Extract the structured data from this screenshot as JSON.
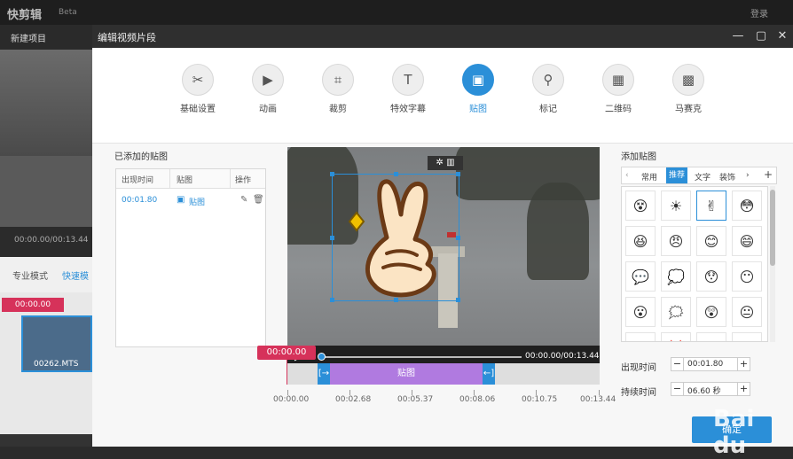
{
  "background_app": {
    "logo": "快剪辑",
    "beta": "Beta",
    "login": "登录",
    "new_project": "新建项目",
    "time_readout": "00:00.00/00:13.44",
    "mode_pro": "专业模式",
    "mode_fast": "快速模",
    "timeline_marker": "00:00.00",
    "clip_name": "00262.MTS"
  },
  "dialog": {
    "title": "编辑视频片段",
    "window_buttons": {
      "minimize": "—",
      "maximize": "▢",
      "close": "✕"
    }
  },
  "tabs": [
    {
      "label": "基础设置",
      "icon": "scissors-icon",
      "glyph": "✂"
    },
    {
      "label": "动画",
      "icon": "play-box-icon",
      "glyph": "▶"
    },
    {
      "label": "裁剪",
      "icon": "crop-icon",
      "glyph": "⌗"
    },
    {
      "label": "特效字幕",
      "icon": "text-icon",
      "glyph": "T"
    },
    {
      "label": "贴图",
      "icon": "image-icon",
      "glyph": "▣"
    },
    {
      "label": "标记",
      "icon": "pin-icon",
      "glyph": "⚲"
    },
    {
      "label": "二维码",
      "icon": "qrcode-icon",
      "glyph": "▦"
    },
    {
      "label": "马赛克",
      "icon": "mosaic-icon",
      "glyph": "▩"
    }
  ],
  "active_tab": "贴图",
  "added_stickers": {
    "title": "已添加的贴图",
    "columns": [
      "出现时间",
      "贴图",
      "操作"
    ],
    "rows": [
      {
        "time": "00:01.80",
        "sticker": "贴图"
      }
    ]
  },
  "player": {
    "time": "00:00.00/00:13.44",
    "progress": 0.0
  },
  "timeline": {
    "marker": "00:00.00",
    "sticker_clip_label": "贴图",
    "ruler_labels": [
      "00:00.00",
      "00:02.68",
      "00:05.37",
      "00:08.06",
      "00:10.75",
      "00:13.44"
    ]
  },
  "add_sticker": {
    "title": "添加贴图",
    "categories": [
      "常用",
      "推荐",
      "文字",
      "装饰"
    ],
    "active_category": "推荐",
    "stickers": [
      "😵",
      "☀",
      "✌",
      "😳",
      "😆",
      "😠",
      "😊",
      "😄",
      "💬",
      "💭",
      "😯",
      "😶",
      "😮",
      "🗯",
      "😲",
      "😐",
      "😀",
      "💢",
      "😣",
      "😑"
    ]
  },
  "appear_time": {
    "label": "出现时间",
    "value": "00:01.80"
  },
  "duration": {
    "label": "持续时间",
    "value": "06.60 秒"
  },
  "ok_button": "确定",
  "watermark": "Bai du"
}
